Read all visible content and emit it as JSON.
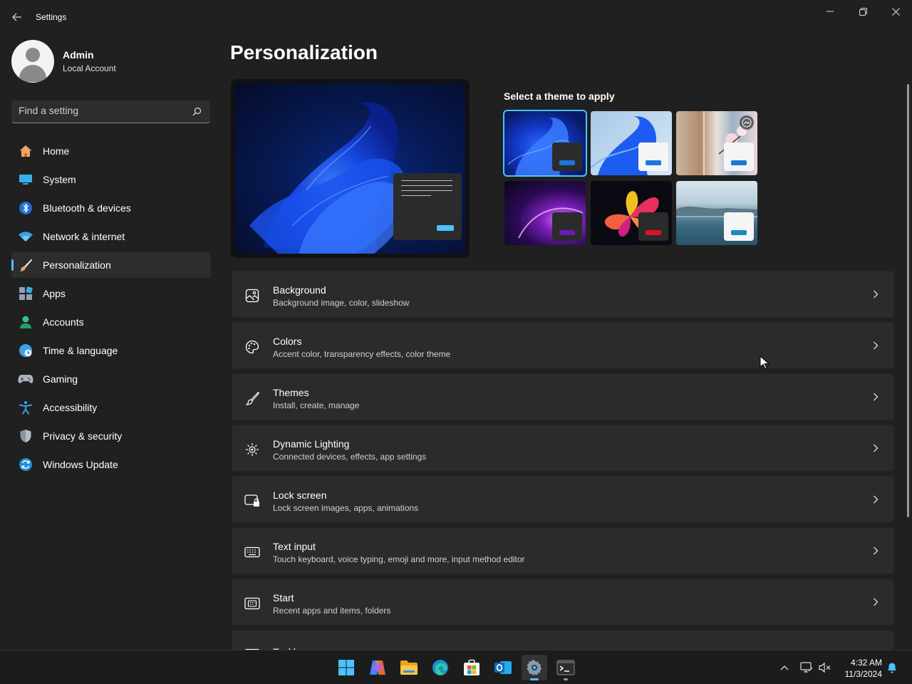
{
  "titlebar": {
    "app_title": "Settings"
  },
  "profile": {
    "name": "Admin",
    "account_type": "Local Account"
  },
  "search": {
    "placeholder": "Find a setting"
  },
  "nav": {
    "items": [
      {
        "label": "Home",
        "icon": "home-icon"
      },
      {
        "label": "System",
        "icon": "system-icon"
      },
      {
        "label": "Bluetooth & devices",
        "icon": "bluetooth-icon"
      },
      {
        "label": "Network & internet",
        "icon": "wifi-icon"
      },
      {
        "label": "Personalization",
        "icon": "brush-icon",
        "active": true
      },
      {
        "label": "Apps",
        "icon": "apps-icon"
      },
      {
        "label": "Accounts",
        "icon": "accounts-icon"
      },
      {
        "label": "Time & language",
        "icon": "globe-icon"
      },
      {
        "label": "Gaming",
        "icon": "gamepad-icon"
      },
      {
        "label": "Accessibility",
        "icon": "accessibility-icon"
      },
      {
        "label": "Privacy & security",
        "icon": "shield-icon"
      },
      {
        "label": "Windows Update",
        "icon": "update-icon"
      }
    ]
  },
  "main": {
    "page_title": "Personalization",
    "theme_label": "Select a theme to apply",
    "settings": [
      {
        "title": "Background",
        "subtitle": "Background image, color, slideshow",
        "icon": "image-icon"
      },
      {
        "title": "Colors",
        "subtitle": "Accent color, transparency effects, color theme",
        "icon": "palette-icon"
      },
      {
        "title": "Themes",
        "subtitle": "Install, create, manage",
        "icon": "brush-icon"
      },
      {
        "title": "Dynamic Lighting",
        "subtitle": "Connected devices, effects, app settings",
        "icon": "lighting-icon"
      },
      {
        "title": "Lock screen",
        "subtitle": "Lock screen images, apps, animations",
        "icon": "lock-screen-icon"
      },
      {
        "title": "Text input",
        "subtitle": "Touch keyboard, voice typing, emoji and more, input method editor",
        "icon": "keyboard-icon"
      },
      {
        "title": "Start",
        "subtitle": "Recent apps and items, folders",
        "icon": "start-icon"
      },
      {
        "title": "Taskbar",
        "subtitle": "",
        "icon": "taskbar-icon"
      }
    ]
  },
  "colors": {
    "accent": "#4cc2ff",
    "background": "#202020",
    "card": "#2b2b2b"
  },
  "taskbar": {
    "time": "4:32 AM",
    "date": "11/3/2024"
  }
}
